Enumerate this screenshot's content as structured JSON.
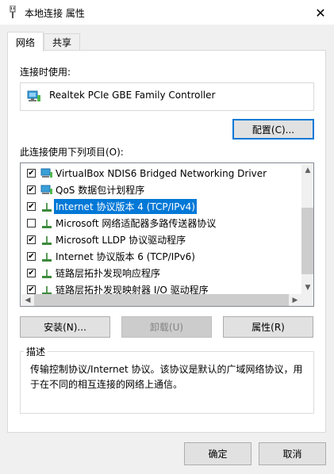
{
  "window": {
    "title": "本地连接 属性",
    "close_glyph": "✕"
  },
  "tabs": [
    {
      "label": "网络",
      "active": true
    },
    {
      "label": "共享",
      "active": false
    }
  ],
  "connect_using": {
    "label": "连接时使用:",
    "adapter_name": "Realtek PCIe GBE Family Controller",
    "configure_button": "配置(C)..."
  },
  "items_section": {
    "label": "此连接使用下列项目(O):",
    "items": [
      {
        "label": "VirtualBox NDIS6 Bridged Networking Driver",
        "checked": true,
        "icon": "network-adapter-icon"
      },
      {
        "label": "QoS 数据包计划程序",
        "checked": true,
        "icon": "network-adapter-icon"
      },
      {
        "label": "Internet 协议版本 4 (TCP/IPv4)",
        "checked": true,
        "icon": "protocol-icon",
        "selected": true
      },
      {
        "label": "Microsoft 网络适配器多路传送器协议",
        "checked": false,
        "icon": "protocol-icon"
      },
      {
        "label": "Microsoft LLDP 协议驱动程序",
        "checked": true,
        "icon": "protocol-icon"
      },
      {
        "label": "Internet 协议版本 6 (TCP/IPv6)",
        "checked": true,
        "icon": "protocol-icon"
      },
      {
        "label": "链路层拓扑发现响应程序",
        "checked": true,
        "icon": "protocol-icon"
      },
      {
        "label": "链路层拓扑发现映射器 I/O 驱动程序",
        "checked": true,
        "icon": "protocol-icon"
      }
    ]
  },
  "item_buttons": {
    "install": "安装(N)...",
    "uninstall": "卸载(U)",
    "properties": "属性(R)"
  },
  "description": {
    "title": "描述",
    "text": "传输控制协议/Internet 协议。该协议是默认的广域网络协议，用于在不同的相互连接的网络上通信。"
  },
  "dialog_buttons": {
    "ok": "确定",
    "cancel": "取消"
  },
  "colors": {
    "selection": "#0078d7",
    "accent_border": "#0078d7"
  }
}
